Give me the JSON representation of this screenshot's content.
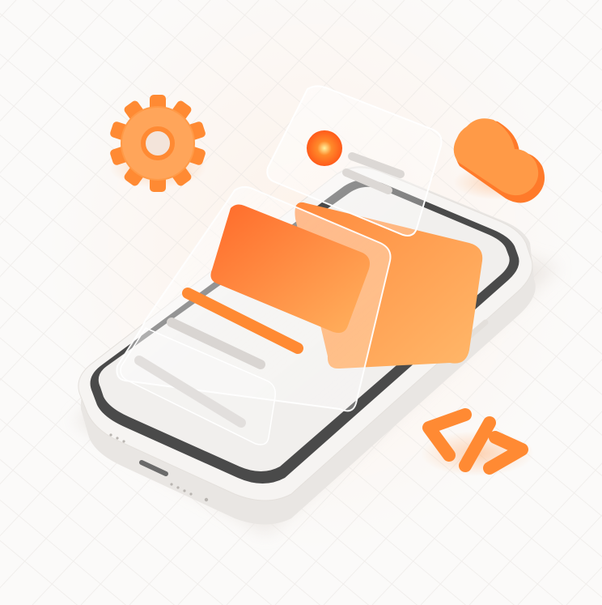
{
  "illustration": {
    "subject": "",
    "icons": [
      "gear-icon",
      "cloud-icon",
      "code-icon"
    ],
    "colors": {
      "accent": "#ff7a2f",
      "accent_light": "#ffb066",
      "phone_body": "#f4f2f0",
      "phone_bezel": "#4a4a4a",
      "screen": "#f1efed",
      "glass": "#ffffff",
      "grid": "#e9e6e3"
    }
  }
}
